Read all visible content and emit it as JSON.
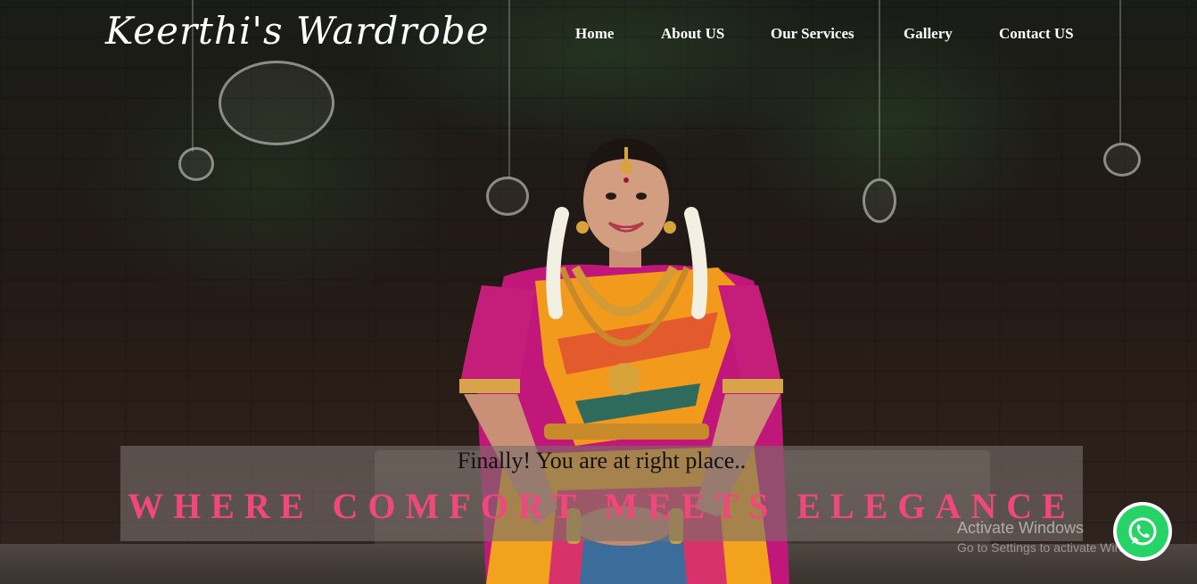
{
  "brand": {
    "logo_text": "Keerthi's Wardrobe"
  },
  "nav": {
    "items": [
      {
        "label": "Home"
      },
      {
        "label": "About US"
      },
      {
        "label": "Our Services"
      },
      {
        "label": "Gallery"
      },
      {
        "label": "Contact US"
      }
    ]
  },
  "hero": {
    "tagline": "Finally! You are at right place..",
    "headline": "WHERE COMFORT MEETS ELEGANCE",
    "accent_color": "#f0487a"
  },
  "overlay": {
    "activate_title": "Activate Windows",
    "activate_subtitle": "Go to Settings to activate Windows."
  },
  "floating": {
    "whatsapp_icon": "whatsapp-icon",
    "whatsapp_color": "#25d366"
  }
}
